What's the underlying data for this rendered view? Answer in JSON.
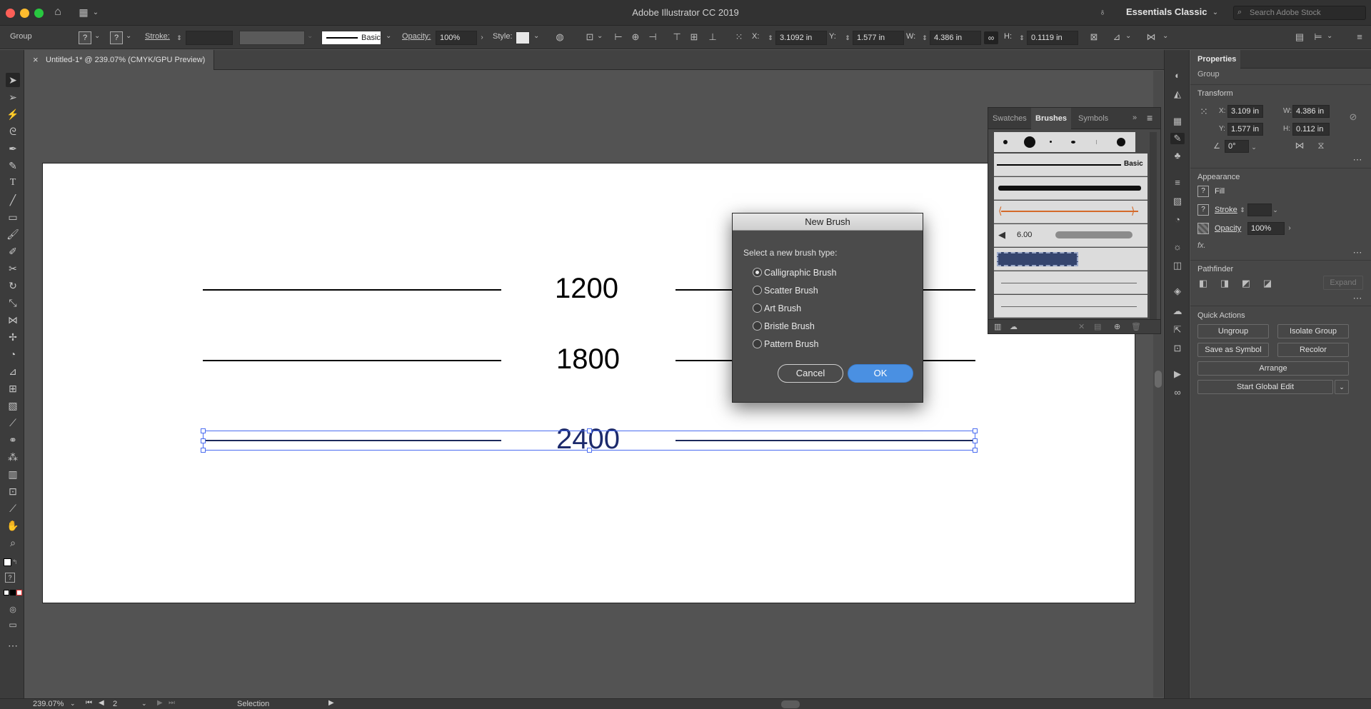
{
  "app": {
    "title": "Adobe Illustrator CC 2019",
    "workspace": "Essentials Classic",
    "search_placeholder": "Search Adobe Stock"
  },
  "control_bar": {
    "selection_type": "Group",
    "stroke_label": "Stroke:",
    "brush_name": "Basic",
    "opacity_label": "Opacity:",
    "opacity_value": "100%",
    "style_label": "Style:",
    "x_label": "X:",
    "x_value": "3.1092 in",
    "y_label": "Y:",
    "y_value": "1.577 in",
    "w_label": "W:",
    "w_value": "4.386 in",
    "h_label": "H:",
    "h_value": "0.1119 in"
  },
  "document_tab": {
    "title": "Untitled-1* @ 239.07% (CMYK/GPU Preview)",
    "close": "×"
  },
  "artboard": {
    "labels": [
      "1200",
      "1800",
      "2400"
    ]
  },
  "dialog": {
    "title": "New Brush",
    "prompt": "Select a new brush type:",
    "options": [
      "Calligraphic Brush",
      "Scatter Brush",
      "Art Brush",
      "Bristle Brush",
      "Pattern Brush"
    ],
    "selected": "Calligraphic Brush",
    "cancel": "Cancel",
    "ok": "OK"
  },
  "brushes_panel": {
    "tabs": [
      "Swatches",
      "Brushes",
      "Symbols"
    ],
    "active_tab": "Brushes",
    "basic_label": "Basic",
    "brush_size": "6.00"
  },
  "properties": {
    "title": "Properties",
    "selection": "Group",
    "transform": {
      "heading": "Transform",
      "x_label": "X:",
      "x": "3.109 in",
      "y_label": "Y:",
      "y": "1.577 in",
      "w_label": "W:",
      "w": "4.386 in",
      "h_label": "H:",
      "h": "0.112 in",
      "angle": "0°"
    },
    "appearance": {
      "heading": "Appearance",
      "fill": "Fill",
      "stroke": "Stroke",
      "opacity": "Opacity",
      "opacity_value": "100%",
      "fx": "fx."
    },
    "pathfinder": {
      "heading": "Pathfinder",
      "expand": "Expand"
    },
    "quick_actions": {
      "heading": "Quick Actions",
      "ungroup": "Ungroup",
      "isolate": "Isolate Group",
      "save_symbol": "Save as Symbol",
      "recolor": "Recolor",
      "arrange": "Arrange",
      "global_edit": "Start Global Edit"
    }
  },
  "status": {
    "zoom": "239.07%",
    "page": "2",
    "tool": "Selection"
  },
  "colors": {
    "accent": "#4a90e2",
    "selection": "#3b5bdb"
  }
}
